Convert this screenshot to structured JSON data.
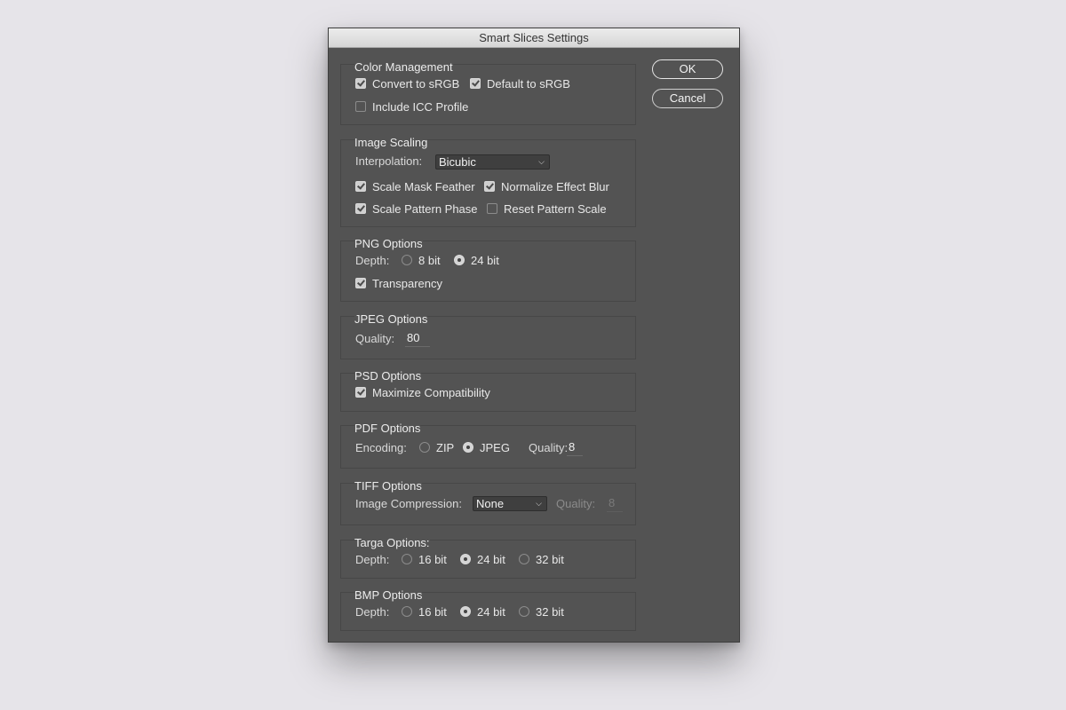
{
  "window": {
    "title": "Smart Slices Settings"
  },
  "buttons": {
    "ok": "OK",
    "cancel": "Cancel"
  },
  "color_management": {
    "title": "Color Management",
    "convert_srgb": "Convert to sRGB",
    "default_srgb": "Default to sRGB",
    "include_icc": "Include ICC Profile"
  },
  "image_scaling": {
    "title": "Image Scaling",
    "interpolation_label": "Interpolation:",
    "interpolation_value": "Bicubic",
    "scale_mask_feather": "Scale Mask Feather",
    "normalize_effect_blur": "Normalize Effect Blur",
    "scale_pattern_phase": "Scale Pattern Phase",
    "reset_pattern_scale": "Reset Pattern Scale"
  },
  "png_options": {
    "title": "PNG Options",
    "depth_label": "Depth:",
    "opt_8": "8 bit",
    "opt_24": "24 bit",
    "transparency": "Transparency"
  },
  "jpeg_options": {
    "title": "JPEG Options",
    "quality_label": "Quality:",
    "quality_value": "80"
  },
  "psd_options": {
    "title": "PSD Options",
    "maximize_compat": "Maximize Compatibility"
  },
  "pdf_options": {
    "title": "PDF Options",
    "encoding_label": "Encoding:",
    "zip": "ZIP",
    "jpeg": "JPEG",
    "quality_label": "Quality:",
    "quality_value": "8"
  },
  "tiff_options": {
    "title": "TIFF Options",
    "compression_label": "Image Compression:",
    "compression_value": "None",
    "quality_label": "Quality:",
    "quality_value": "8"
  },
  "targa_options": {
    "title": "Targa Options:",
    "depth_label": "Depth:",
    "opt_16": "16 bit",
    "opt_24": "24 bit",
    "opt_32": "32 bit"
  },
  "bmp_options": {
    "title": "BMP Options",
    "depth_label": "Depth:",
    "opt_16": "16 bit",
    "opt_24": "24 bit",
    "opt_32": "32 bit"
  }
}
